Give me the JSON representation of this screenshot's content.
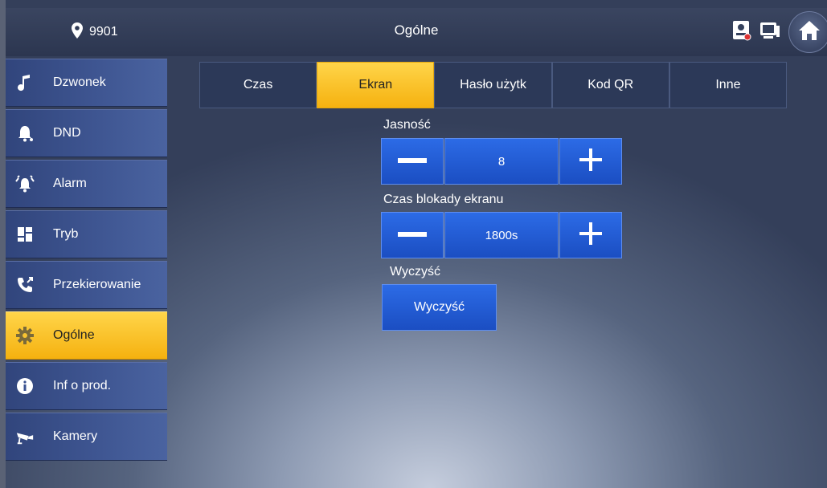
{
  "header": {
    "location_id": "9901",
    "title": "Ogólne",
    "icons": [
      "map-pin-icon",
      "door-station-icon",
      "monitor-icon",
      "home-icon"
    ]
  },
  "sidebar": {
    "items": [
      {
        "label": "Dzwonek",
        "icon": "music-note-icon",
        "active": false
      },
      {
        "label": "DND",
        "icon": "bell-icon",
        "active": false
      },
      {
        "label": "Alarm",
        "icon": "alarm-icon",
        "active": false
      },
      {
        "label": "Tryb",
        "icon": "grid-icon",
        "active": false
      },
      {
        "label": "Przekierowanie",
        "icon": "call-forward-icon",
        "active": false
      },
      {
        "label": "Ogólne",
        "icon": "gear-icon",
        "active": true
      },
      {
        "label": "Inf o prod.",
        "icon": "info-icon",
        "active": false
      },
      {
        "label": "Kamery",
        "icon": "camera-icon",
        "active": false
      }
    ]
  },
  "tabs": [
    {
      "label": "Czas",
      "active": false
    },
    {
      "label": "Ekran",
      "active": true
    },
    {
      "label": "Hasło użytk",
      "active": false
    },
    {
      "label": "Kod QR",
      "active": false
    },
    {
      "label": "Inne",
      "active": false
    }
  ],
  "settings": {
    "brightness": {
      "label": "Jasność",
      "value": "8"
    },
    "screen_lock": {
      "label": "Czas blokady ekranu",
      "value": "1800s"
    },
    "clear": {
      "label": "Wyczyść",
      "button_label": "Wyczyść"
    }
  },
  "colors": {
    "accent": "#f5b10f",
    "button": "#1f56cf",
    "sidebar": "#3a5290"
  }
}
